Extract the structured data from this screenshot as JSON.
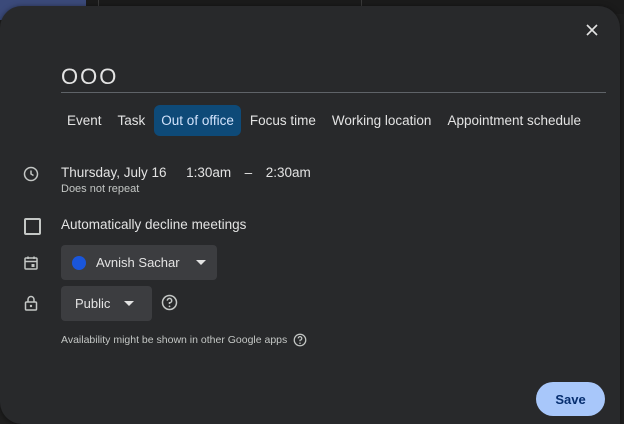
{
  "dialog": {
    "title_value": "OOO",
    "tabs": [
      {
        "label": "Event"
      },
      {
        "label": "Task"
      },
      {
        "label": "Out of office"
      },
      {
        "label": "Focus time"
      },
      {
        "label": "Working location"
      },
      {
        "label": "Appointment schedule"
      }
    ],
    "active_tab": "Out of office",
    "date": "Thursday, July 16",
    "start_time": "1:30am",
    "dash": "–",
    "end_time": "2:30am",
    "repeat": "Does not repeat",
    "decline_label": "Automatically decline meetings",
    "owner_name": "Avnish Sachar",
    "visibility": "Public",
    "availability_note": "Availability might be shown in other Google apps",
    "save_label": "Save"
  },
  "colors": {
    "dialog_bg": "#28292b",
    "active_tab_bg": "#0e4a78",
    "save_bg": "#a8c7fa",
    "owner_dot": "#1a56db"
  },
  "icons": {
    "close": "close-icon",
    "time": "clock-icon",
    "calendar": "calendar-icon",
    "lock": "lock-icon",
    "help": "help-circle-icon",
    "dropdown": "caret-down-icon"
  }
}
